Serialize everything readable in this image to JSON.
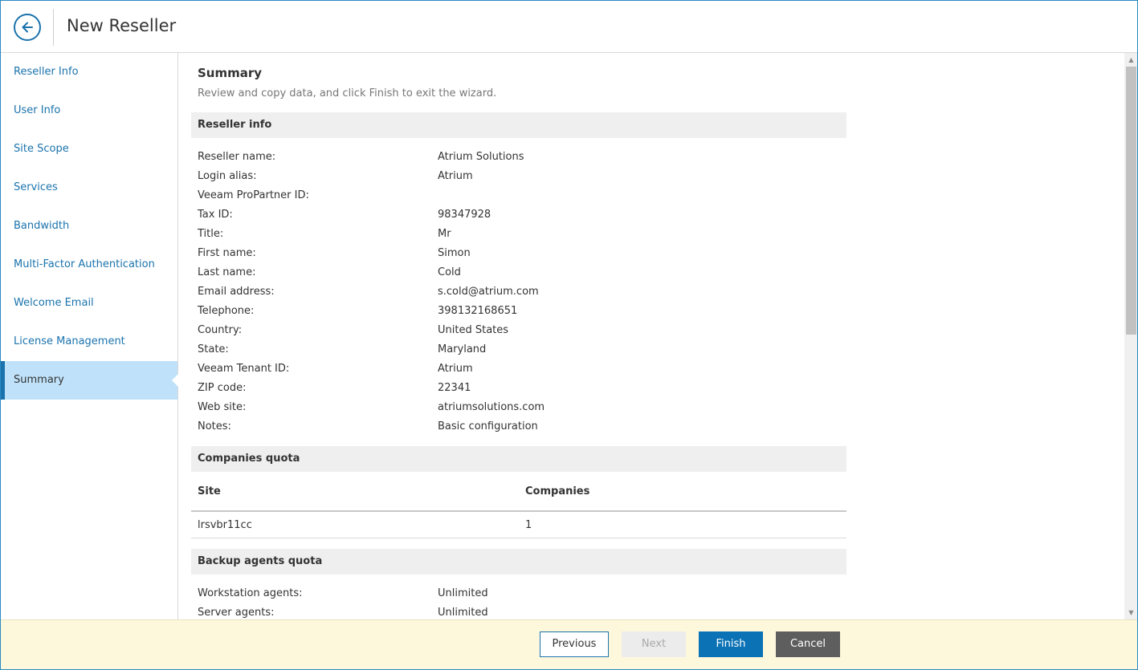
{
  "header": {
    "title": "New Reseller"
  },
  "sidebar": {
    "items": [
      {
        "label": "Reseller Info"
      },
      {
        "label": "User Info"
      },
      {
        "label": "Site Scope"
      },
      {
        "label": "Services"
      },
      {
        "label": "Bandwidth"
      },
      {
        "label": "Multi-Factor Authentication"
      },
      {
        "label": "Welcome Email"
      },
      {
        "label": "License Management"
      },
      {
        "label": "Summary"
      }
    ],
    "active_index": 8
  },
  "summary": {
    "title": "Summary",
    "description": "Review and copy data, and click Finish to exit the wizard."
  },
  "reseller_info": {
    "heading": "Reseller info",
    "rows": [
      {
        "label": "Reseller name:",
        "value": "Atrium Solutions"
      },
      {
        "label": "Login alias:",
        "value": "Atrium"
      },
      {
        "label": "Veeam ProPartner ID:",
        "value": ""
      },
      {
        "label": "Tax ID:",
        "value": "98347928"
      },
      {
        "label": "Title:",
        "value": "Mr"
      },
      {
        "label": "First name:",
        "value": "Simon"
      },
      {
        "label": "Last name:",
        "value": "Cold"
      },
      {
        "label": "Email address:",
        "value": "s.cold@atrium.com"
      },
      {
        "label": "Telephone:",
        "value": "398132168651"
      },
      {
        "label": "Country:",
        "value": "United States"
      },
      {
        "label": "State:",
        "value": "Maryland"
      },
      {
        "label": "Veeam Tenant ID:",
        "value": "Atrium"
      },
      {
        "label": "ZIP code:",
        "value": "22341"
      },
      {
        "label": "Web site:",
        "value": "atriumsolutions.com"
      },
      {
        "label": "Notes:",
        "value": "Basic configuration"
      }
    ]
  },
  "companies_quota": {
    "heading": "Companies quota",
    "columns": [
      "Site",
      "Companies"
    ],
    "rows": [
      [
        "lrsvbr11cc",
        "1"
      ]
    ]
  },
  "backup_agents_quota": {
    "heading": "Backup agents quota",
    "rows": [
      {
        "label": "Workstation agents:",
        "value": "Unlimited"
      },
      {
        "label": "Server agents:",
        "value": "Unlimited"
      }
    ]
  },
  "footer": {
    "previous": "Previous",
    "next": "Next",
    "finish": "Finish",
    "cancel": "Cancel"
  },
  "colors": {
    "accent": "#1a73ad",
    "active_bg": "#bfe2fa",
    "footer_bg": "#fdf8dc",
    "finish_bg": "#0b72b5",
    "cancel_bg": "#5e5e5e"
  }
}
